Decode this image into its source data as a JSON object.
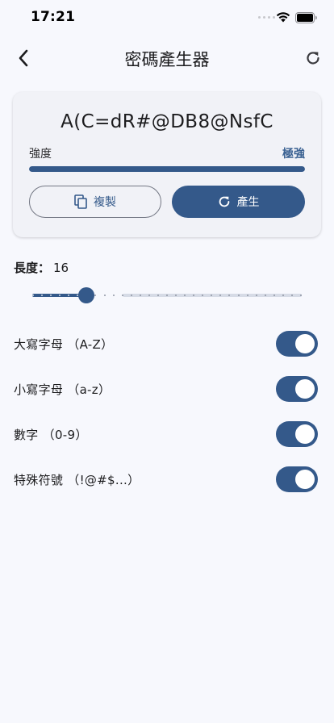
{
  "status_bar": {
    "time": "17:21"
  },
  "app_bar": {
    "title": "密碼產生器",
    "back_icon": "chevron-left-icon",
    "refresh_icon": "refresh-icon"
  },
  "password_card": {
    "password": "A(C=dR#@DB8@NsfC",
    "strength_label": "強度",
    "strength_value": "極強",
    "strength_level": 1.0,
    "copy_label": "複製",
    "copy_icon": "copy-icon",
    "generate_label": "產生",
    "generate_icon": "refresh-icon"
  },
  "length": {
    "label": "長度：",
    "value": "16",
    "min": 4,
    "max": 64,
    "current": 16
  },
  "options": [
    {
      "label": "大寫字母 （A-Z）",
      "enabled": true
    },
    {
      "label": "小寫字母 （a-z）",
      "enabled": true
    },
    {
      "label": "數字 （0-9）",
      "enabled": true
    },
    {
      "label": "特殊符號 （!@#$...）",
      "enabled": true
    }
  ],
  "colors": {
    "primary": "#34598a",
    "background": "#f7f8fd",
    "card": "#f1f2f7",
    "track": "#d6dbe6"
  }
}
